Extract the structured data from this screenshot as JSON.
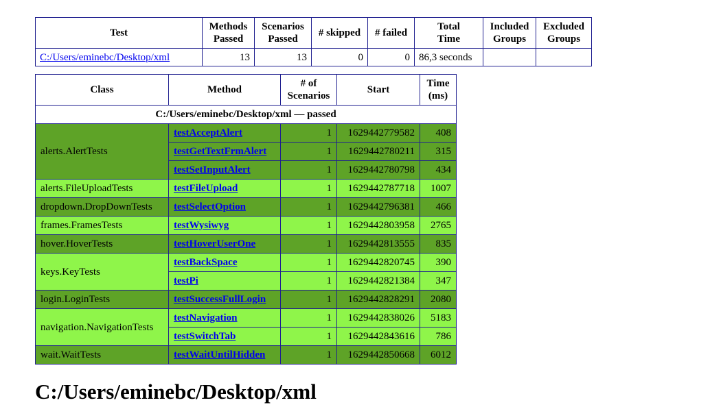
{
  "summary": {
    "headers": [
      "Test",
      "Methods Passed",
      "Scenarios Passed",
      "# skipped",
      "# failed",
      "Total Time",
      "Included Groups",
      "Excluded Groups"
    ],
    "row": {
      "test": "C:/Users/eminebc/Desktop/xml",
      "methods_passed": "13",
      "scenarios_passed": "13",
      "skipped": "0",
      "failed": "0",
      "total_time": "86,3 seconds",
      "included_groups": "",
      "excluded_groups": ""
    }
  },
  "methods": {
    "headers": [
      "Class",
      "Method",
      "# of Scenarios",
      "Start",
      "Time (ms)"
    ],
    "group_title": "C:/Users/eminebc/Desktop/xml — passed",
    "classes": [
      {
        "name": "alerts.AlertTests",
        "rows": [
          {
            "method": "testAcceptAlert",
            "scenarios": "1",
            "start": "1629442779582",
            "time": "408"
          },
          {
            "method": "testGetTextFrmAlert",
            "scenarios": "1",
            "start": "1629442780211",
            "time": "315"
          },
          {
            "method": "testSetInputAlert",
            "scenarios": "1",
            "start": "1629442780798",
            "time": "434"
          }
        ]
      },
      {
        "name": "alerts.FileUploadTests",
        "rows": [
          {
            "method": "testFileUpload",
            "scenarios": "1",
            "start": "1629442787718",
            "time": "1007"
          }
        ]
      },
      {
        "name": "dropdown.DropDownTests",
        "rows": [
          {
            "method": "testSelectOption",
            "scenarios": "1",
            "start": "1629442796381",
            "time": "466"
          }
        ]
      },
      {
        "name": "frames.FramesTests",
        "rows": [
          {
            "method": "testWysiwyg",
            "scenarios": "1",
            "start": "1629442803958",
            "time": "2765"
          }
        ]
      },
      {
        "name": "hover.HoverTests",
        "rows": [
          {
            "method": "testHoverUserOne",
            "scenarios": "1",
            "start": "1629442813555",
            "time": "835"
          }
        ]
      },
      {
        "name": "keys.KeyTests",
        "rows": [
          {
            "method": "testBackSpace",
            "scenarios": "1",
            "start": "1629442820745",
            "time": "390"
          },
          {
            "method": "testPi",
            "scenarios": "1",
            "start": "1629442821384",
            "time": "347"
          }
        ]
      },
      {
        "name": "login.LoginTests",
        "rows": [
          {
            "method": "testSuccessFullLogin",
            "scenarios": "1",
            "start": "1629442828291",
            "time": "2080"
          }
        ]
      },
      {
        "name": "navigation.NavigationTests",
        "rows": [
          {
            "method": "testNavigation",
            "scenarios": "1",
            "start": "1629442838026",
            "time": "5183"
          },
          {
            "method": "testSwitchTab",
            "scenarios": "1",
            "start": "1629442843616",
            "time": "786"
          }
        ]
      },
      {
        "name": "wait.WaitTests",
        "rows": [
          {
            "method": "testWaitUntilHidden",
            "scenarios": "1",
            "start": "1629442850668",
            "time": "6012"
          }
        ]
      }
    ]
  },
  "section_title": "C:/Users/eminebc/Desktop/xml",
  "colors": {
    "row_dark": "#5ea327",
    "row_light": "#8ff54a",
    "border": "#1f1f8f",
    "link": "#0000ee"
  }
}
